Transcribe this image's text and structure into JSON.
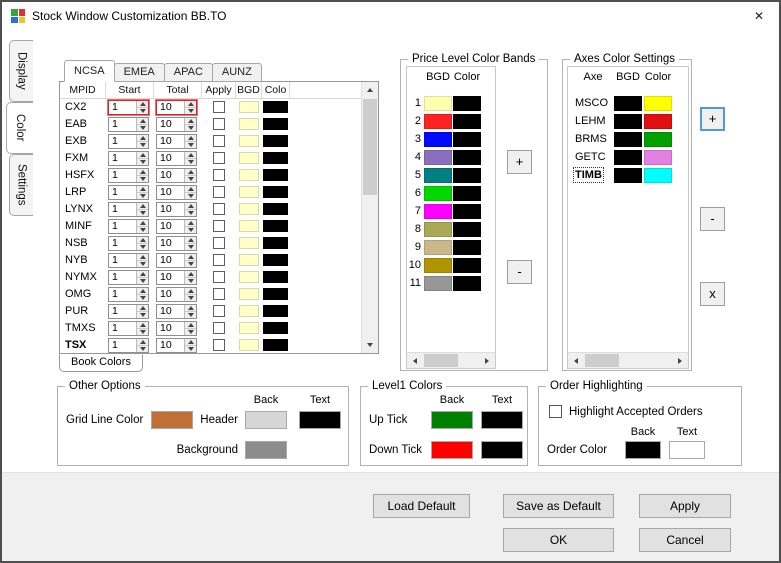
{
  "window": {
    "title": "Stock Window Customization BB.TO",
    "close_glyph": "✕",
    "icon_colors": [
      "#3ca03c",
      "#d83434",
      "#2b6fd4",
      "#e8c822"
    ]
  },
  "side_tabs": [
    {
      "label": "Display",
      "selected": false
    },
    {
      "label": "Color",
      "selected": true
    },
    {
      "label": "Settings",
      "selected": false
    }
  ],
  "region_tabs": [
    {
      "label": "NCSA",
      "selected": true
    },
    {
      "label": "EMEA",
      "selected": false
    },
    {
      "label": "APAC",
      "selected": false
    },
    {
      "label": "AUNZ",
      "selected": false
    }
  ],
  "mpid_table": {
    "columns": [
      "MPID",
      "Start",
      "Total",
      "Apply",
      "BGD",
      "Colo"
    ],
    "bottom_tab": "Book Colors",
    "default_bgd": "#ffffc8",
    "default_color": "#000000",
    "rows": [
      {
        "mpid": "CX2",
        "start": "1",
        "total": "10",
        "apply": false,
        "highlight": true
      },
      {
        "mpid": "EAB",
        "start": "1",
        "total": "10",
        "apply": false
      },
      {
        "mpid": "EXB",
        "start": "1",
        "total": "10",
        "apply": false
      },
      {
        "mpid": "FXM",
        "start": "1",
        "total": "10",
        "apply": false
      },
      {
        "mpid": "HSFX",
        "start": "1",
        "total": "10",
        "apply": false
      },
      {
        "mpid": "LRP",
        "start": "1",
        "total": "10",
        "apply": false
      },
      {
        "mpid": "LYNX",
        "start": "1",
        "total": "10",
        "apply": false
      },
      {
        "mpid": "MINF",
        "start": "1",
        "total": "10",
        "apply": false
      },
      {
        "mpid": "NSB",
        "start": "1",
        "total": "10",
        "apply": false
      },
      {
        "mpid": "NYB",
        "start": "1",
        "total": "10",
        "apply": false
      },
      {
        "mpid": "NYMX",
        "start": "1",
        "total": "10",
        "apply": false
      },
      {
        "mpid": "OMG",
        "start": "1",
        "total": "10",
        "apply": false
      },
      {
        "mpid": "PUR",
        "start": "1",
        "total": "10",
        "apply": false
      },
      {
        "mpid": "TMXS",
        "start": "1",
        "total": "10",
        "apply": false
      },
      {
        "mpid": "TSX",
        "start": "1",
        "total": "10",
        "apply": false,
        "bold": true
      }
    ]
  },
  "price_bands": {
    "title": "Price Level Color Bands",
    "columns": [
      "BGD",
      "Color"
    ],
    "add_label": "+",
    "remove_label": "-",
    "rows": [
      {
        "num": "1",
        "bgd": "#ffffb0",
        "color": "#000000"
      },
      {
        "num": "2",
        "bgd": "#ff2222",
        "color": "#000000"
      },
      {
        "num": "3",
        "bgd": "#0008ff",
        "color": "#000000"
      },
      {
        "num": "4",
        "bgd": "#8a6fc0",
        "color": "#000000"
      },
      {
        "num": "5",
        "bgd": "#008080",
        "color": "#000000"
      },
      {
        "num": "6",
        "bgd": "#00d800",
        "color": "#000000"
      },
      {
        "num": "7",
        "bgd": "#ff00ff",
        "color": "#000000"
      },
      {
        "num": "8",
        "bgd": "#a9a957",
        "color": "#000000"
      },
      {
        "num": "9",
        "bgd": "#c9b98a",
        "color": "#000000"
      },
      {
        "num": "10",
        "bgd": "#b09400",
        "color": "#000000"
      },
      {
        "num": "11",
        "bgd": "#979797",
        "color": "#000000"
      }
    ]
  },
  "axes_colors": {
    "title": "Axes Color Settings",
    "columns": [
      "Axe",
      "BGD",
      "Color"
    ],
    "buttons": [
      {
        "label": "+",
        "focused": true
      },
      {
        "label": "-",
        "focused": false
      },
      {
        "label": "x",
        "focused": false
      }
    ],
    "rows": [
      {
        "axe": "MSCO",
        "bgd": "#000000",
        "color": "#ffff00",
        "selected": false
      },
      {
        "axe": "LEHM",
        "bgd": "#000000",
        "color": "#e01010",
        "selected": false
      },
      {
        "axe": "BRMS",
        "bgd": "#000000",
        "color": "#00a000",
        "selected": false
      },
      {
        "axe": "GETC",
        "bgd": "#000000",
        "color": "#e47fe4",
        "selected": false
      },
      {
        "axe": "TIMB",
        "bgd": "#000000",
        "color": "#00ffff",
        "selected": true
      }
    ]
  },
  "other_options": {
    "title": "Other Options",
    "back_header": "Back",
    "text_header": "Text",
    "grid_line_label": "Grid Line Color",
    "grid_line_color": "#c06f35",
    "header_label": "Header",
    "header_back": "#d6d6d6",
    "header_text": "#000000",
    "background_label": "Background",
    "background_color": "#8c8c8c"
  },
  "level1_colors": {
    "title": "Level1 Colors",
    "back_header": "Back",
    "text_header": "Text",
    "rows": [
      {
        "label": "Up Tick",
        "back": "#008000",
        "text": "#000000"
      },
      {
        "label": "Down Tick",
        "back": "#ff0000",
        "text": "#000000"
      }
    ]
  },
  "order_highlighting": {
    "title": "Order Highlighting",
    "checkbox_label": "Highlight Accepted Orders",
    "checkbox_checked": false,
    "back_header": "Back",
    "text_header": "Text",
    "order_color_label": "Order Color",
    "back": "#000000",
    "text": "#ffffff"
  },
  "footer": {
    "load_default": "Load Default",
    "save_as_default": "Save as Default",
    "apply": "Apply",
    "ok": "OK",
    "cancel": "Cancel"
  }
}
